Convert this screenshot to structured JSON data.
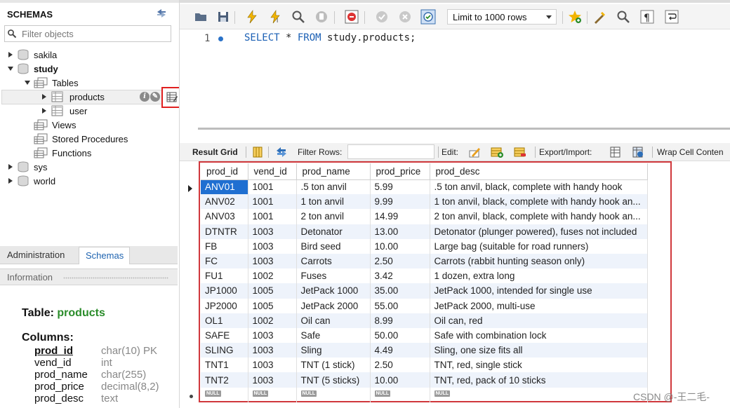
{
  "navigator": {
    "title": "SCHEMAS",
    "filter_placeholder": "Filter objects",
    "schemas": [
      {
        "name": "sakila",
        "expanded": false
      },
      {
        "name": "study",
        "expanded": true,
        "folders": [
          "Tables",
          "Views",
          "Stored Procedures",
          "Functions"
        ],
        "tables": [
          "products",
          "user"
        ]
      },
      {
        "name": "sys",
        "expanded": false
      },
      {
        "name": "world",
        "expanded": false
      }
    ],
    "tabs": {
      "administration": "Administration",
      "schemas": "Schemas"
    },
    "info_header": "Information",
    "info": {
      "table_label": "Table:",
      "table_name": "products",
      "columns_label": "Columns:",
      "columns": [
        {
          "name": "prod_id",
          "type": "char(10) PK"
        },
        {
          "name": "vend_id",
          "type": "int"
        },
        {
          "name": "prod_name",
          "type": "char(255)"
        },
        {
          "name": "prod_price",
          "type": "decimal(8,2)"
        },
        {
          "name": "prod_desc",
          "type": "text"
        }
      ]
    }
  },
  "toolbar": {
    "limit_value": "Limit to 1000 rows"
  },
  "editor": {
    "line_number": "1",
    "sql_select": "SELECT",
    "sql_star": " * ",
    "sql_from": "FROM",
    "sql_rest": " study.products;"
  },
  "result_toolbar": {
    "result_grid": "Result Grid",
    "filter_rows": "Filter Rows:",
    "edit": "Edit:",
    "export_import": "Export/Import:",
    "wrap": "Wrap Cell Conten"
  },
  "grid": {
    "columns": [
      "prod_id",
      "vend_id",
      "prod_name",
      "prod_price",
      "prod_desc"
    ],
    "rows": [
      [
        "ANV01",
        "1001",
        ".5 ton anvil",
        "5.99",
        ".5 ton anvil, black, complete with handy hook"
      ],
      [
        "ANV02",
        "1001",
        "1 ton anvil",
        "9.99",
        "1 ton anvil, black, complete with handy hook an..."
      ],
      [
        "ANV03",
        "1001",
        "2 ton anvil",
        "14.99",
        "2 ton anvil, black, complete with handy hook an..."
      ],
      [
        "DTNTR",
        "1003",
        "Detonator",
        "13.00",
        "Detonator (plunger powered), fuses not included"
      ],
      [
        "FB",
        "1003",
        "Bird seed",
        "10.00",
        "Large bag (suitable for road runners)"
      ],
      [
        "FC",
        "1003",
        "Carrots",
        "2.50",
        "Carrots (rabbit hunting season only)"
      ],
      [
        "FU1",
        "1002",
        "Fuses",
        "3.42",
        "1 dozen, extra long"
      ],
      [
        "JP1000",
        "1005",
        "JetPack 1000",
        "35.00",
        "JetPack 1000, intended for single use"
      ],
      [
        "JP2000",
        "1005",
        "JetPack 2000",
        "55.00",
        "JetPack 2000, multi-use"
      ],
      [
        "OL1",
        "1002",
        "Oil can",
        "8.99",
        "Oil can, red"
      ],
      [
        "SAFE",
        "1003",
        "Safe",
        "50.00",
        "Safe with combination lock"
      ],
      [
        "SLING",
        "1003",
        "Sling",
        "4.49",
        "Sling, one size fits all"
      ],
      [
        "TNT1",
        "1003",
        "TNT (1 stick)",
        "2.50",
        "TNT, red, single stick"
      ],
      [
        "TNT2",
        "1003",
        "TNT (5 sticks)",
        "10.00",
        "TNT, red, pack of 10 sticks"
      ]
    ],
    "null_label": "NULL"
  },
  "watermark": "CSDN @-王二毛-",
  "colors": {
    "accent_blue": "#1f6fd1",
    "highlight_red": "#e02020",
    "green": "#2a8c2a"
  }
}
